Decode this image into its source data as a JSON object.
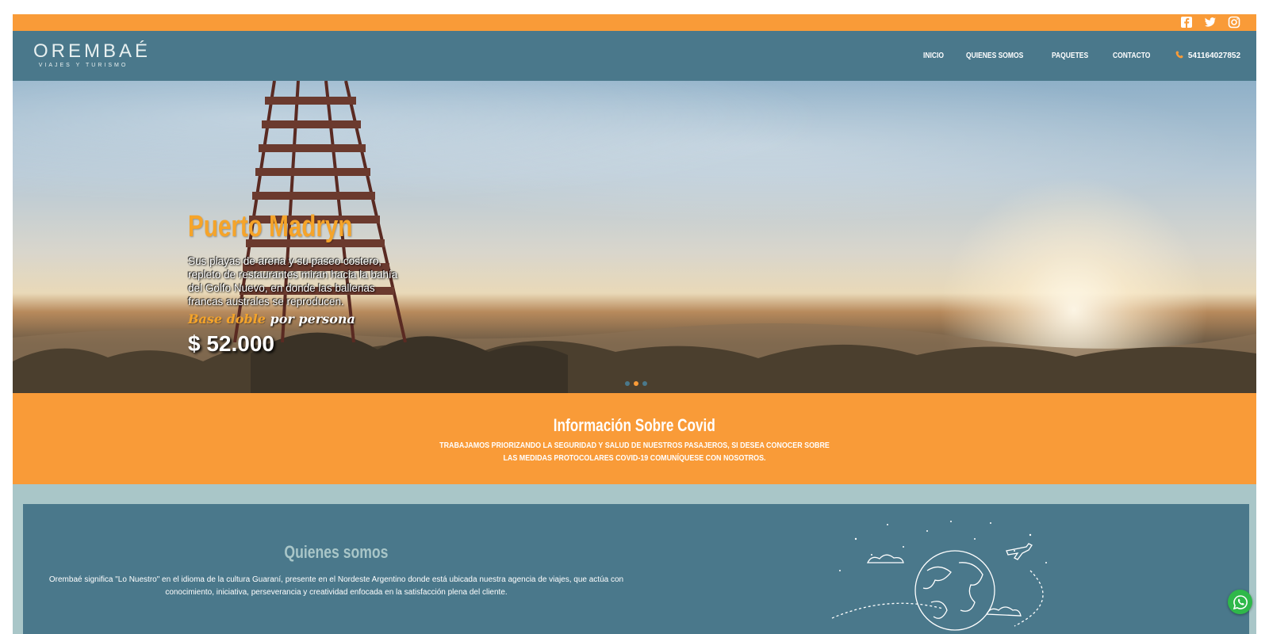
{
  "topbar": {
    "socials": [
      "facebook-icon",
      "twitter-icon",
      "instagram-icon"
    ],
    "color": "#f99b38"
  },
  "header": {
    "logo_name": "OREMBAÉ",
    "logo_sub": "VIAJES Y TURISMO",
    "nav": [
      "INICIO",
      "QUIENES SOMOS",
      "PAQUETES",
      "CONTACTO"
    ],
    "phone": "541164027852",
    "color": "#4a788b"
  },
  "hero": {
    "title": "Puerto Madryn",
    "description": "Sus playas de arena y su paseo costero, repleto de restaurantes miran hacia la bahía del Golfo Nuevo, en donde las ballenas francas australes se reproducen.",
    "base_orange": "Base doble",
    "base_white": " por persona",
    "price": "$ 52.000",
    "slides": 3,
    "active_slide": 2
  },
  "covid": {
    "title": "Información Sobre Covid",
    "text": "TRABAJAMOS PRIORIZANDO LA SEGURIDAD Y SALUD DE NUESTROS PASAJEROS, SI DESEA CONOCER SOBRE LAS MEDIDAS PROTOCOLARES COVID-19 COMUNÍQUESE CON NOSOTROS."
  },
  "about": {
    "title": "Quienes somos",
    "text": "Orembaé significa \"Lo Nuestro\" en el idioma de la cultura Guaraní, presente en el Nordeste Argentino donde está ubicada nuestra agencia de viajes, que actúa con conocimiento, iniciativa, perseverancia y creatividad enfocada en la satisfacción plena del cliente."
  },
  "whatsapp": {
    "icon": "whatsapp-icon"
  }
}
